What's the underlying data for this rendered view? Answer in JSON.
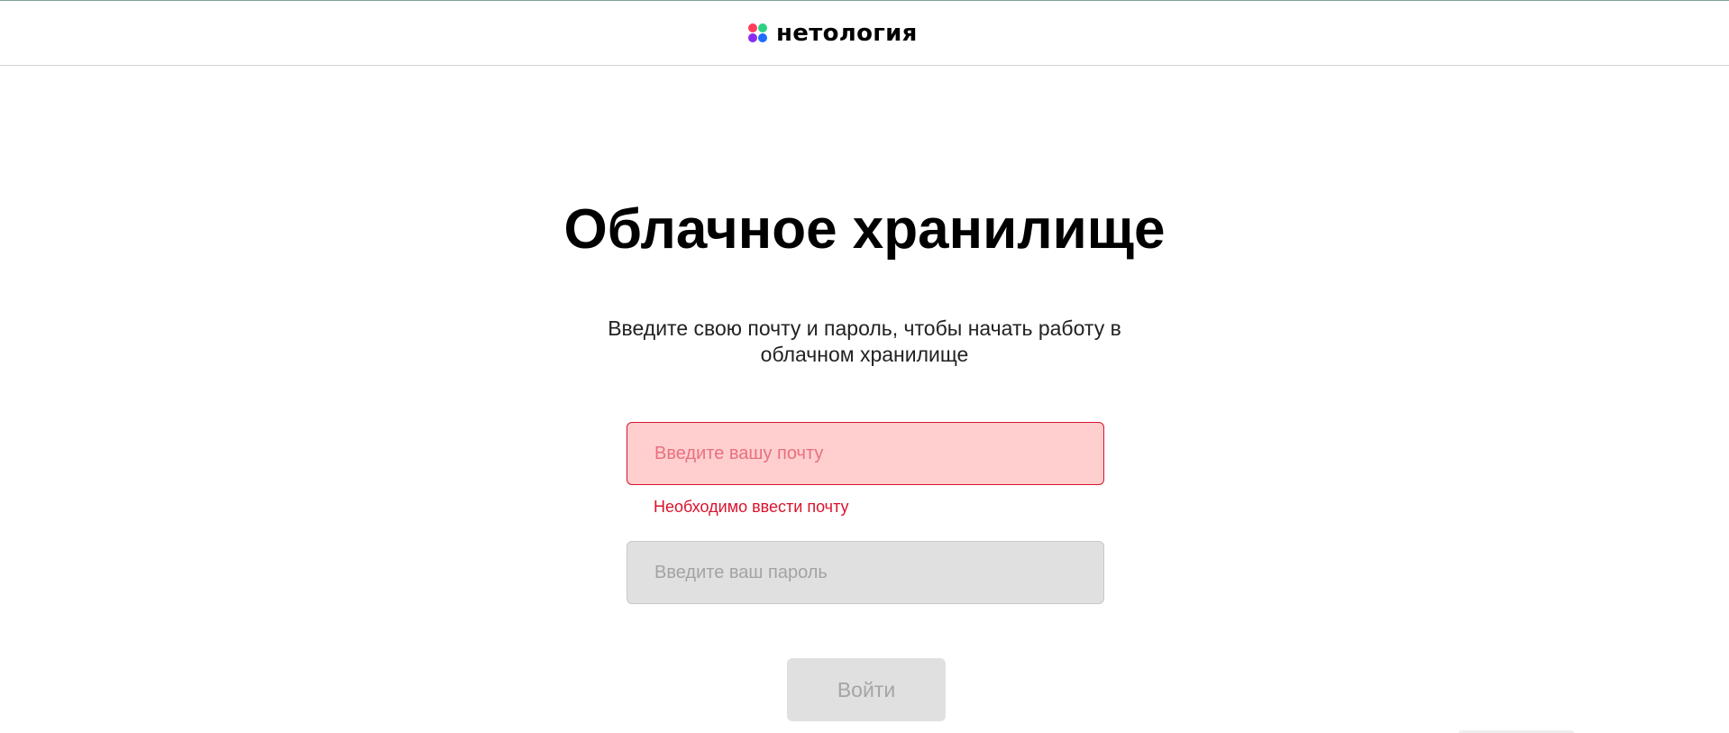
{
  "header": {
    "logo_text": "нетология",
    "logo_colors": [
      "#ff3e5c",
      "#2ed183",
      "#8a2cf0",
      "#1e6bff"
    ]
  },
  "main": {
    "title": "Облачное хранилище",
    "subtitle": "Введите свою почту и пароль, чтобы начать работу в облачном хранилище"
  },
  "form": {
    "email": {
      "value": "",
      "placeholder": "Введите вашу почту",
      "error": "Необходимо ввести почту"
    },
    "password": {
      "value": "",
      "placeholder": "Введите ваш пароль"
    },
    "submit_label": "Войти"
  },
  "colors": {
    "error": "#d9142c",
    "error_bg": "#ffcfd0",
    "input_bg": "#e0e0e0"
  }
}
